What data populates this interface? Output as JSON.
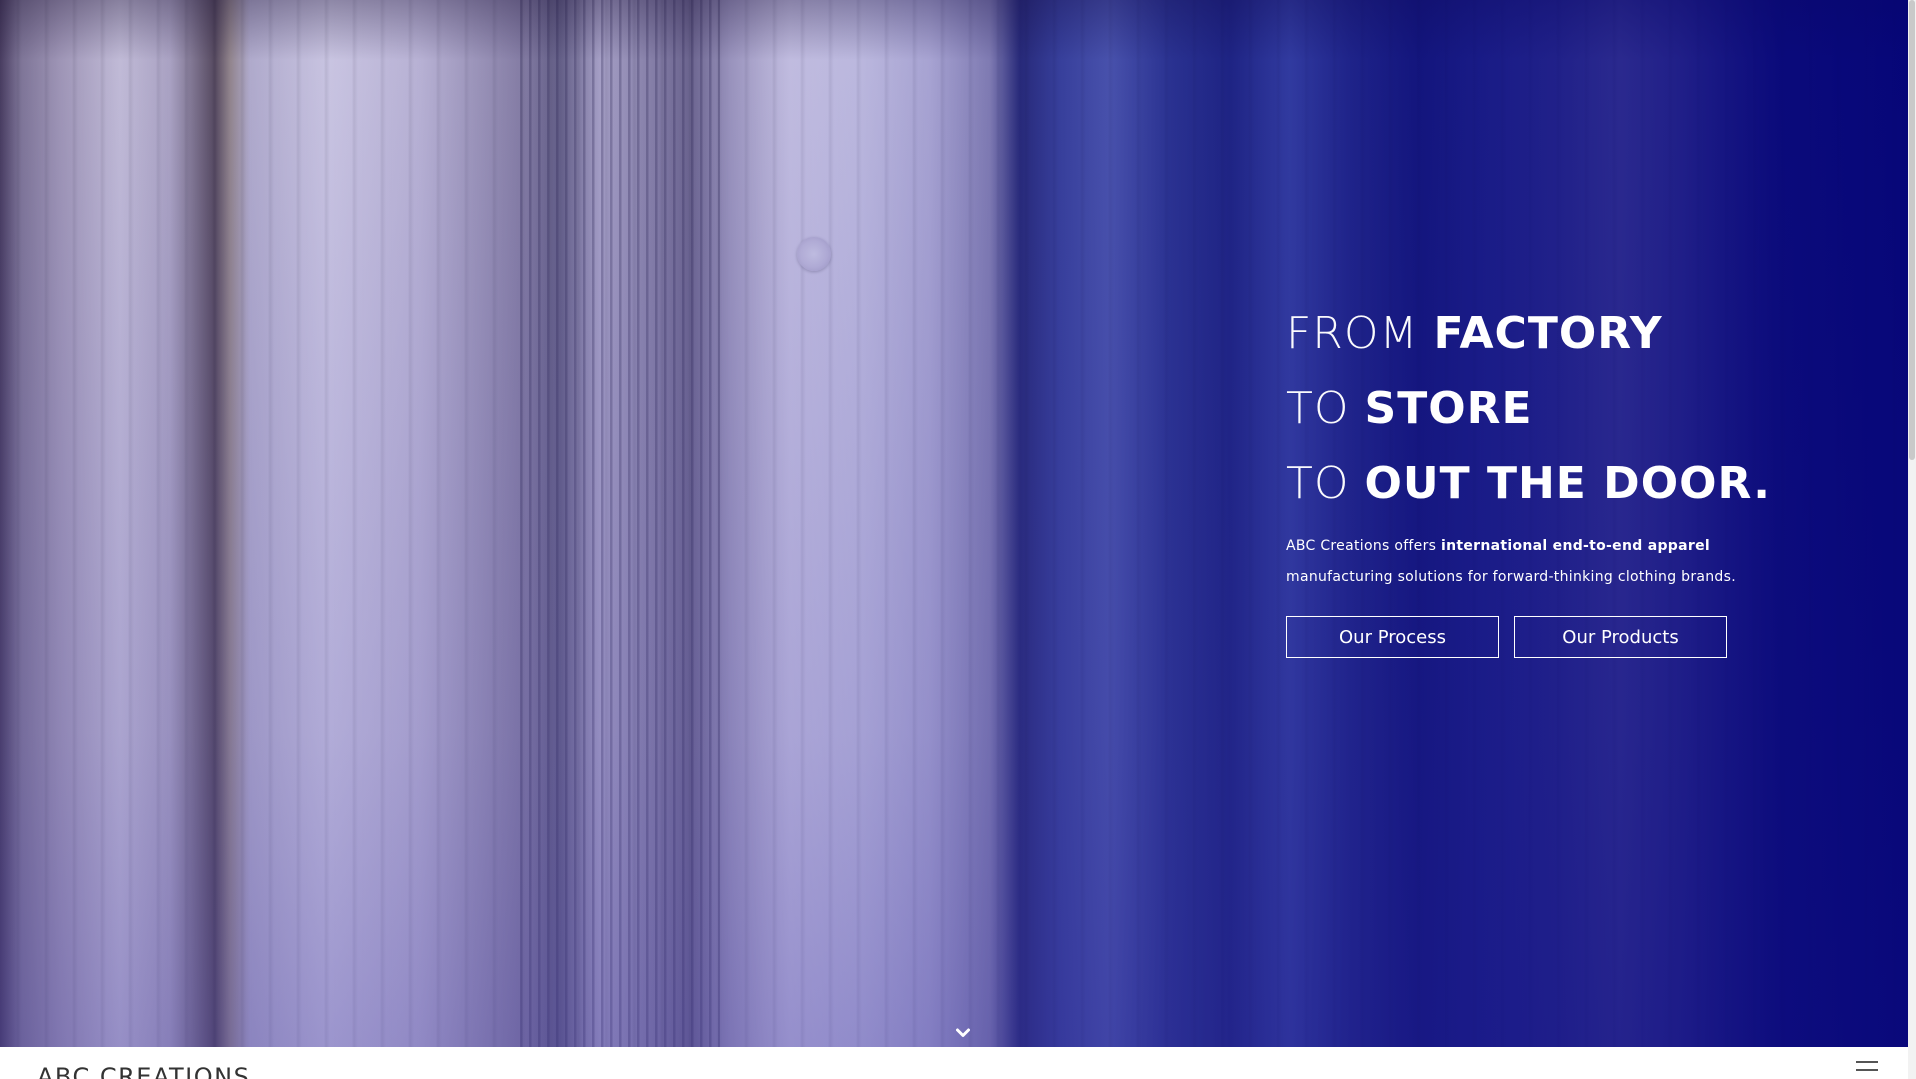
{
  "hero": {
    "headline": {
      "line1_light": "FROM ",
      "line1_strong": "FACTORY",
      "line2_light": "TO ",
      "line2_strong": "STORE",
      "line3_light": "TO ",
      "line3_strong": "OUT THE DOOR."
    },
    "tagline": {
      "prefix": "ABC Creations offers ",
      "emphasis": "international end-to-end apparel",
      "suffix": "manufacturing solutions for forward-thinking clothing brands."
    },
    "buttons": {
      "process": "Our Process",
      "products": "Our Products"
    },
    "scroll_icon": "chevron-down-icon"
  },
  "header": {
    "brand": "ABC CREATIONS",
    "menu_icon": "hamburger-menu-icon"
  },
  "colors": {
    "overlay_blue": "#0d0d7a",
    "text_white": "#ffffff",
    "brand_text": "#333333"
  }
}
